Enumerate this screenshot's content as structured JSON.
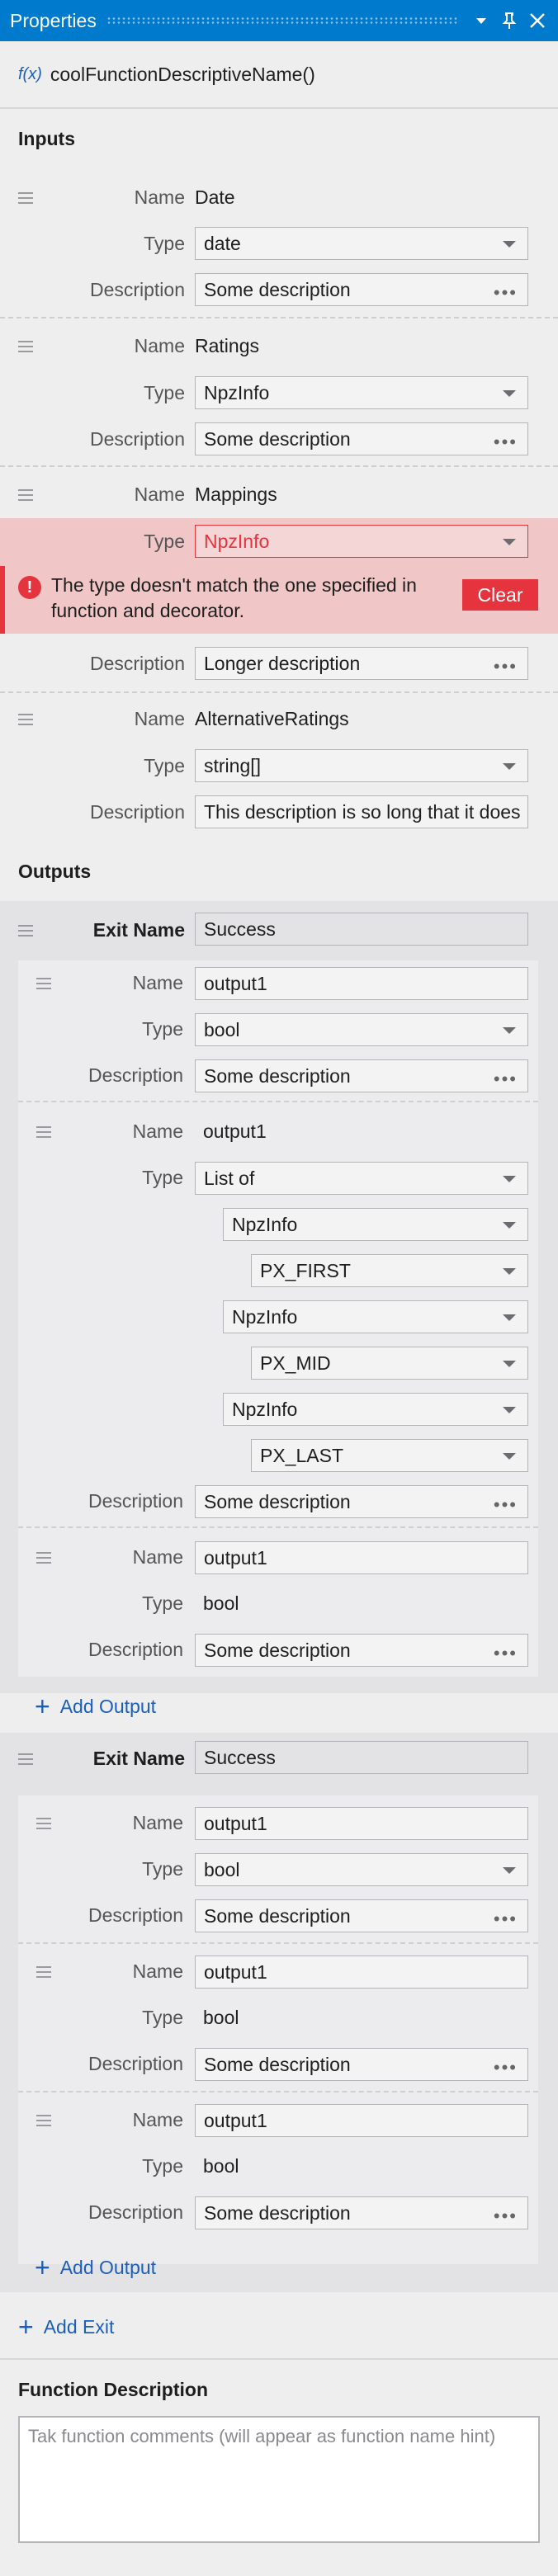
{
  "window": {
    "title": "Properties"
  },
  "function": {
    "fx": "f(x)",
    "name": "coolFunctionDescriptiveName()"
  },
  "labels": {
    "name": "Name",
    "type": "Type",
    "description": "Description",
    "exit_name": "Exit Name"
  },
  "inputs": {
    "title": "Inputs",
    "items": [
      {
        "name": "Date",
        "type": "date",
        "description": "Some description"
      },
      {
        "name": "Ratings",
        "type": "NpzInfo",
        "description": "Some description"
      },
      {
        "name": "Mappings",
        "type": "NpzInfo",
        "description": "Longer description",
        "error": {
          "message": "The type doesn't match the one specified in function and decorator.",
          "button": "Clear"
        }
      },
      {
        "name": "AlternativeRatings",
        "type": "string[]",
        "description": "This description is so long that it does"
      }
    ]
  },
  "outputs": {
    "title": "Outputs",
    "exits": [
      {
        "exit_name": "Success",
        "outputs": [
          {
            "name": "output1",
            "type": "bool",
            "description": "Some description"
          },
          {
            "name": "output1",
            "type": "List of",
            "description": "Some description",
            "list": [
              {
                "type": "NpzInfo",
                "value": "PX_FIRST"
              },
              {
                "type": "NpzInfo",
                "value": "PX_MID"
              },
              {
                "type": "NpzInfo",
                "value": "PX_LAST"
              }
            ]
          },
          {
            "name": "output1",
            "type": "bool",
            "description": "Some description"
          }
        ],
        "add_output": "Add Output"
      },
      {
        "exit_name": "Success",
        "outputs": [
          {
            "name": "output1",
            "type": "bool",
            "description": "Some description"
          },
          {
            "name": "output1",
            "type": "bool",
            "description": "Some description"
          },
          {
            "name": "output1",
            "type": "bool",
            "description": "Some description"
          }
        ],
        "add_output": "Add Output"
      }
    ],
    "add_exit": "Add Exit"
  },
  "function_description": {
    "title": "Function Description",
    "placeholder": "Tak function comments (will appear as function name hint)"
  },
  "colors": {
    "accent": "#007acc",
    "link": "#1b5fbd",
    "error": "#e5343d",
    "error_bg": "#f0c6c6"
  }
}
